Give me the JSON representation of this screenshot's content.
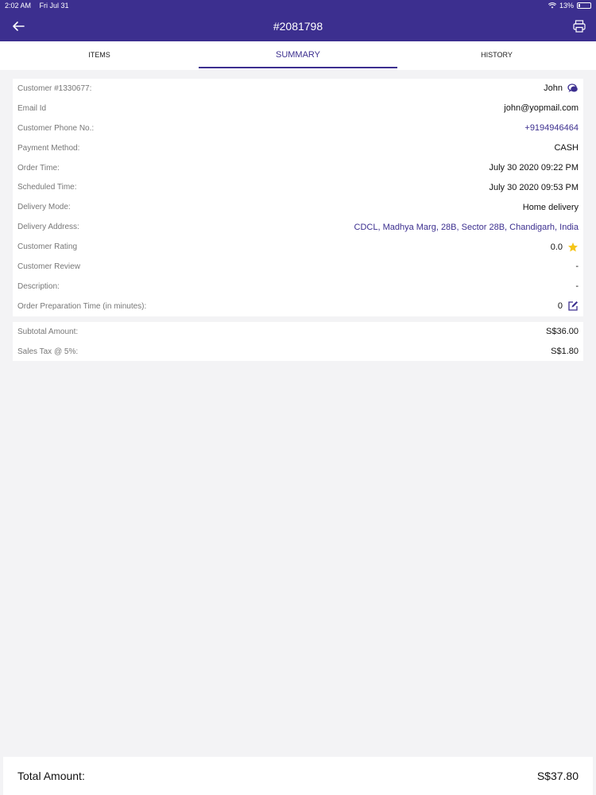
{
  "status_bar": {
    "time": "2:02 AM",
    "date": "Fri Jul 31",
    "battery": "13%"
  },
  "header": {
    "title": "#2081798",
    "back_icon": "arrow-left-icon",
    "print_icon": "printer-icon"
  },
  "tabs": [
    {
      "label": "ITEMS",
      "active": false
    },
    {
      "label": "SUMMARY",
      "active": true
    },
    {
      "label": "HISTORY",
      "active": false
    }
  ],
  "details": [
    {
      "label": "Customer #1330677:",
      "value": "John",
      "icon": "chat-icon"
    },
    {
      "label": "Email Id",
      "value": "john@yopmail.com"
    },
    {
      "label": "Customer Phone No.:",
      "value": "+9194946464",
      "link": true
    },
    {
      "label": "Payment Method:",
      "value": "CASH"
    },
    {
      "label": "Order Time:",
      "value": "July 30 2020 09:22 PM"
    },
    {
      "label": "Scheduled Time:",
      "value": "July 30 2020 09:53 PM"
    },
    {
      "label": "Delivery Mode:",
      "value": "Home delivery"
    },
    {
      "label": "Delivery Address:",
      "value": "CDCL, Madhya Marg, 28B, Sector 28B, Chandigarh, India",
      "link": true
    },
    {
      "label": "Customer Rating",
      "value": "0.0",
      "icon": "star-icon"
    },
    {
      "label": "Customer Review",
      "value": "-"
    },
    {
      "label": "Description:",
      "value": "-"
    },
    {
      "label": "Order Preparation Time (in minutes):",
      "value": "0",
      "icon": "edit-icon"
    }
  ],
  "amounts": [
    {
      "label": "Subtotal Amount:",
      "value": "S$36.00"
    },
    {
      "label": "Sales Tax @ 5%:",
      "value": "S$1.80"
    }
  ],
  "total": {
    "label": "Total Amount:",
    "value": "S$37.80"
  },
  "colors": {
    "brand": "#3c2f8f",
    "star": "#f5c518"
  }
}
